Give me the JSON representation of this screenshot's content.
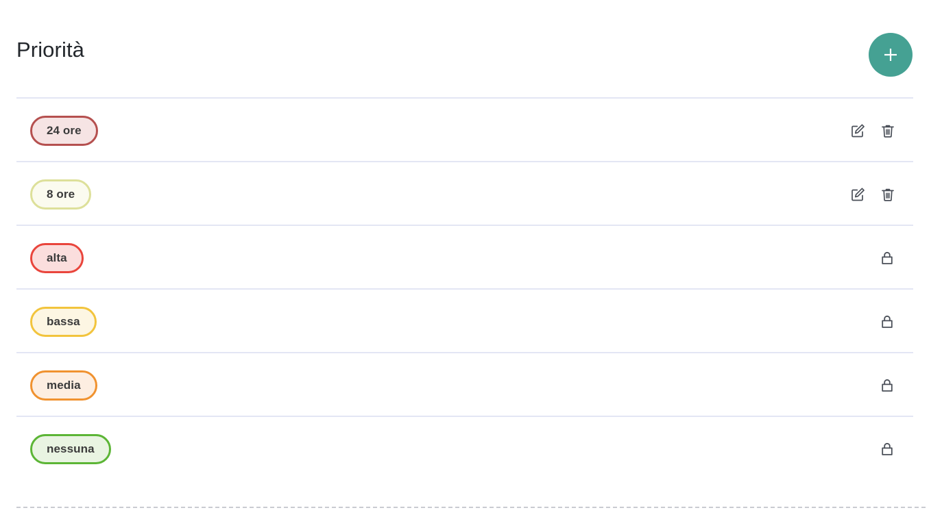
{
  "header": {
    "title": "Priorità",
    "add_button": {
      "label": "+",
      "icon": "plus-icon",
      "color": "#45a193"
    }
  },
  "theme": {
    "background": "#ffffff",
    "divider": "#e3e6f4",
    "dashed_divider": "#c9cbd1",
    "icon_color": "#4a4f58",
    "chip_text": "#3b3b3b",
    "title_color": "#23272c"
  },
  "list": {
    "rows": [
      {
        "label": "24 ore",
        "border_color": "#b5504f",
        "background_color": "#f6e4e4",
        "locked": false,
        "actions": [
          "edit-icon",
          "delete-icon"
        ]
      },
      {
        "label": "8 ore",
        "border_color": "#dde09a",
        "background_color": "#fbfbef",
        "locked": false,
        "actions": [
          "edit-icon",
          "delete-icon"
        ]
      },
      {
        "label": "alta",
        "border_color": "#e9453c",
        "background_color": "#fbdedd",
        "locked": true,
        "actions": [
          "lock-icon"
        ]
      },
      {
        "label": "bassa",
        "border_color": "#f2c43d",
        "background_color": "#fdf6e3",
        "locked": true,
        "actions": [
          "lock-icon"
        ]
      },
      {
        "label": "media",
        "border_color": "#f0922f",
        "background_color": "#fdeee1",
        "locked": true,
        "actions": [
          "lock-icon"
        ]
      },
      {
        "label": "nessuna",
        "border_color": "#5cb536",
        "background_color": "#e9f4e2",
        "locked": true,
        "actions": [
          "lock-icon"
        ]
      }
    ]
  }
}
